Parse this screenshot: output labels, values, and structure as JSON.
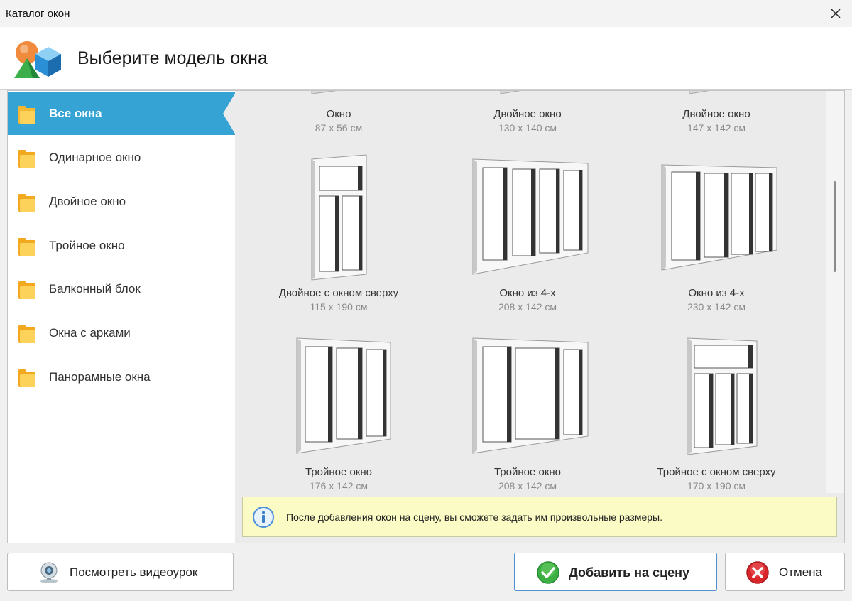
{
  "window": {
    "title": "Каталог окон"
  },
  "header": {
    "title": "Выберите модель окна"
  },
  "sidebar": {
    "items": [
      {
        "label": "Все окна",
        "active": true
      },
      {
        "label": "Одинарное окно"
      },
      {
        "label": "Двойное окно"
      },
      {
        "label": "Тройное окно"
      },
      {
        "label": "Балконный блок"
      },
      {
        "label": "Окна с арками"
      },
      {
        "label": "Панорамные окна"
      }
    ]
  },
  "catalog": {
    "items": [
      {
        "name": "Окно",
        "size": "87 x 56 см",
        "icon": "window-single-icon"
      },
      {
        "name": "Двойное окно",
        "size": "130 x 140 см",
        "icon": "window-double-icon"
      },
      {
        "name": "Двойное окно",
        "size": "147 x 142 см",
        "icon": "window-double-icon"
      },
      {
        "name": "Двойное с окном сверху",
        "size": "115 x 190 см",
        "icon": "window-double-top-icon"
      },
      {
        "name": "Окно из 4-х",
        "size": "208 x 142 см",
        "icon": "window-quad-icon"
      },
      {
        "name": "Окно из 4-х",
        "size": "230 x 142 см",
        "icon": "window-quad-icon"
      },
      {
        "name": "Тройное окно",
        "size": "176 x 142 см",
        "icon": "window-triple-icon"
      },
      {
        "name": "Тройное окно",
        "size": "208 x 142 см",
        "icon": "window-triple-wide-icon"
      },
      {
        "name": "Тройное с окном сверху",
        "size": "170 x 190 см",
        "icon": "window-triple-top-icon"
      }
    ]
  },
  "info": {
    "text": "После добавления окон на сцену, вы сможете задать им произвольные размеры."
  },
  "buttons": {
    "video": "Посмотреть видеоурок",
    "add": "Добавить на сцену",
    "cancel": "Отмена"
  },
  "colors": {
    "accent": "#35a3d4",
    "info_bg": "#fbfbc5",
    "ok_green": "#3cb043",
    "cancel_red": "#d9262b"
  }
}
